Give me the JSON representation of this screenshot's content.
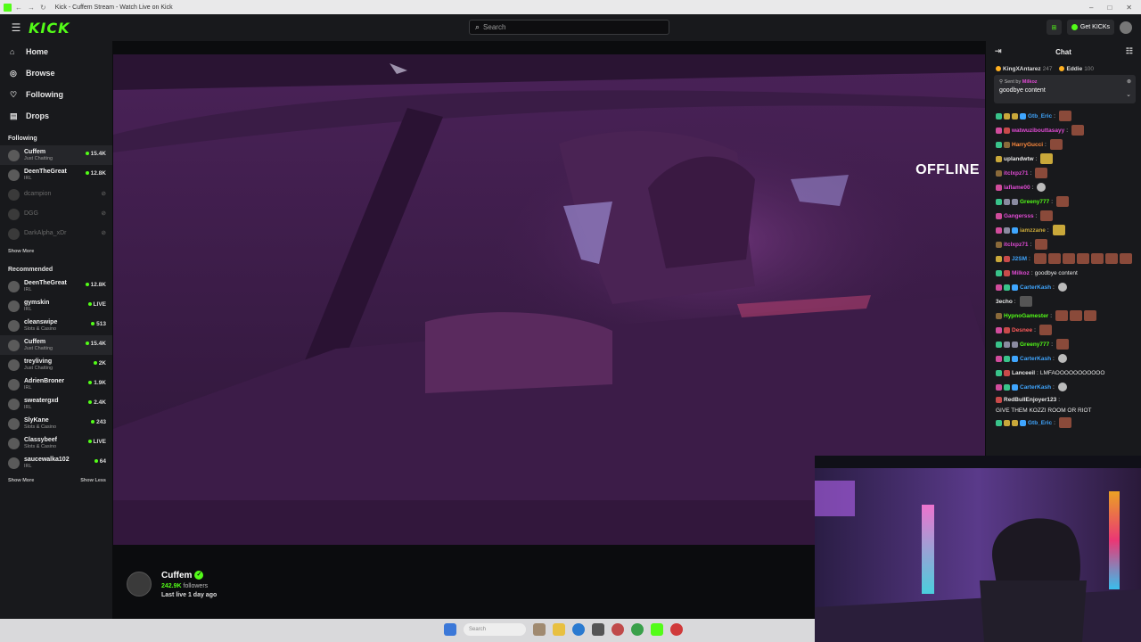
{
  "window": {
    "title": "Kick - Cuffem Stream - Watch Live on Kick"
  },
  "header": {
    "logo": "KICK",
    "search_placeholder": "Search",
    "get_kicks": "Get KICKs"
  },
  "nav": [
    {
      "label": "Home",
      "icon": "home-icon",
      "glyph": "⌂"
    },
    {
      "label": "Browse",
      "icon": "browse-icon",
      "glyph": "◎"
    },
    {
      "label": "Following",
      "icon": "heart-icon",
      "glyph": "♡"
    },
    {
      "label": "Drops",
      "icon": "drops-icon",
      "glyph": "▤"
    }
  ],
  "following": {
    "title": "Following",
    "channels": [
      {
        "name": "Cuffem",
        "category": "Just Chatting",
        "count": "15.4K"
      },
      {
        "name": "DeenTheGreat",
        "category": "IRL",
        "count": "12.8K"
      },
      {
        "name": "dcampion",
        "category": "",
        "count": ""
      },
      {
        "name": "DGG",
        "category": "",
        "count": ""
      },
      {
        "name": "DarkAlpha_xDr",
        "category": "",
        "count": ""
      }
    ],
    "show_more": "Show More"
  },
  "recommended": {
    "title": "Recommended",
    "channels": [
      {
        "name": "DeenTheGreat",
        "category": "IRL",
        "count": "12.8K"
      },
      {
        "name": "gymskin",
        "category": "IRL",
        "count": "LIVE"
      },
      {
        "name": "cleanswipe",
        "category": "Slots & Casino",
        "count": "513"
      },
      {
        "name": "Cuffem",
        "category": "Just Chatting",
        "count": "15.4K"
      },
      {
        "name": "treyliving",
        "category": "Just Chatting",
        "count": "2K"
      },
      {
        "name": "AdrienBroner",
        "category": "IRL",
        "count": "1.9K"
      },
      {
        "name": "sweatergxd",
        "category": "IRL",
        "count": "2.4K"
      },
      {
        "name": "SlyKane",
        "category": "Slots & Casino",
        "count": "243"
      },
      {
        "name": "Classybeef",
        "category": "Slots & Casino",
        "count": "LIVE"
      },
      {
        "name": "saucewalka102",
        "category": "IRL",
        "count": "64"
      }
    ],
    "show_more": "Show More",
    "show_less": "Show Less"
  },
  "player": {
    "status": "OFFLINE"
  },
  "streamer": {
    "name": "Cuffem",
    "followers": "242.9K",
    "followers_label": "followers",
    "last_live": "Last live 1 day ago"
  },
  "chat": {
    "title": "Chat",
    "gifters": [
      {
        "name": "KingXAntarez",
        "amount": "247"
      },
      {
        "name": "Eddie",
        "amount": "100"
      }
    ],
    "pinned": {
      "sent_by_prefix": "Sent by",
      "sent_by": "Milkoz",
      "message": "goodbye content"
    },
    "messages": [
      {
        "user": "Gtb_Eric",
        "color": "#3fa6ff",
        "text": "",
        "badges": [
          "#39c38a",
          "#c9a83a",
          "#c9a83a",
          "#3fa6ff"
        ],
        "emotes": [
          "r"
        ]
      },
      {
        "user": "watwuzibouttasayy",
        "color": "#e14bd4",
        "text": "",
        "badges": [
          "#d04c9b",
          "#c84a4a"
        ],
        "emotes": [
          "r"
        ]
      },
      {
        "user": "HarryGucci",
        "color": "#ff8a3d",
        "text": "",
        "badges": [
          "#39c38a",
          "#8a6a3a"
        ],
        "emotes": [
          "r"
        ]
      },
      {
        "user": "uplandwtw",
        "color": "#e8e8e8",
        "text": "",
        "badges": [
          "#c9a83a"
        ],
        "emotes": [
          "y"
        ]
      },
      {
        "user": "itclxpz71",
        "color": "#e14bd4",
        "text": "",
        "badges": [
          "#8a6a3a"
        ],
        "emotes": [
          "r"
        ]
      },
      {
        "user": "laflame00",
        "color": "#e14bd4",
        "text": "",
        "badges": [
          "#d04c9b"
        ],
        "emotes": [
          "w"
        ]
      },
      {
        "user": "Greeny777",
        "color": "#53fc18",
        "text": "",
        "badges": [
          "#39c38a",
          "#8a8aa0",
          "#8a8aa0"
        ],
        "emotes": [
          "r"
        ]
      },
      {
        "user": "Gangersss",
        "color": "#e14bd4",
        "text": "",
        "badges": [
          "#d04c9b"
        ],
        "emotes": [
          "r"
        ]
      },
      {
        "user": "iamzzane",
        "color": "#c9a83a",
        "text": "",
        "badges": [
          "#d04c9b",
          "#8a8aa0",
          "#3fa6ff"
        ],
        "emotes": [
          "y"
        ]
      },
      {
        "user": "itclxpz71",
        "color": "#e14bd4",
        "text": "",
        "badges": [
          "#8a6a3a"
        ],
        "emotes": [
          "r"
        ]
      },
      {
        "user": "J2SM",
        "color": "#3fa6ff",
        "text": "",
        "badges": [
          "#c9a83a",
          "#c84a4a"
        ],
        "emotes": [
          "r",
          "r",
          "r",
          "r",
          "r",
          "r",
          "r"
        ]
      },
      {
        "user": "Milkoz",
        "color": "#e14bd4",
        "text": "goodbye content",
        "badges": [
          "#39c38a",
          "#c84a4a"
        ],
        "emotes": []
      },
      {
        "user": "CarterKash",
        "color": "#3fa6ff",
        "text": "",
        "badges": [
          "#d04c9b",
          "#39c38a",
          "#3fa6ff"
        ],
        "emotes": [
          "w"
        ]
      },
      {
        "user": "3echo",
        "color": "#e8e8e8",
        "text": "",
        "badges": [],
        "emotes": [
          "d"
        ]
      },
      {
        "user": "HypnoGamester",
        "color": "#53fc18",
        "text": "",
        "badges": [
          "#8a6a3a"
        ],
        "emotes": [
          "r",
          "r",
          "r"
        ]
      },
      {
        "user": "Desnee",
        "color": "#ff5a5a",
        "text": "",
        "badges": [
          "#d04c9b",
          "#c84a4a"
        ],
        "emotes": [
          "r"
        ]
      },
      {
        "user": "Greeny777",
        "color": "#53fc18",
        "text": "",
        "badges": [
          "#39c38a",
          "#8a8aa0",
          "#8a8aa0"
        ],
        "emotes": [
          "r"
        ]
      },
      {
        "user": "CarterKash",
        "color": "#3fa6ff",
        "text": "",
        "badges": [
          "#d04c9b",
          "#39c38a",
          "#3fa6ff"
        ],
        "emotes": [
          "w"
        ]
      },
      {
        "user": "Lanceeil",
        "color": "#e8e8e8",
        "text": "LMFAOOOOOOOOOOO",
        "badges": [
          "#39c38a",
          "#c84a4a"
        ],
        "emotes": []
      },
      {
        "user": "CarterKash",
        "color": "#3fa6ff",
        "text": "",
        "badges": [
          "#d04c9b",
          "#39c38a",
          "#3fa6ff"
        ],
        "emotes": [
          "w"
        ]
      },
      {
        "user": "RedBullEnjoyer123",
        "color": "#e8e8e8",
        "text": "GIVE THEM KOZZI ROOM OR RIOT",
        "badges": [
          "#c84a4a"
        ],
        "emotes": []
      },
      {
        "user": "Gtb_Eric",
        "color": "#3fa6ff",
        "text": "",
        "badges": [
          "#39c38a",
          "#c9a83a",
          "#c9a83a",
          "#3fa6ff"
        ],
        "emotes": [
          "r"
        ]
      }
    ]
  },
  "taskbar": {
    "search_placeholder": "Search"
  }
}
